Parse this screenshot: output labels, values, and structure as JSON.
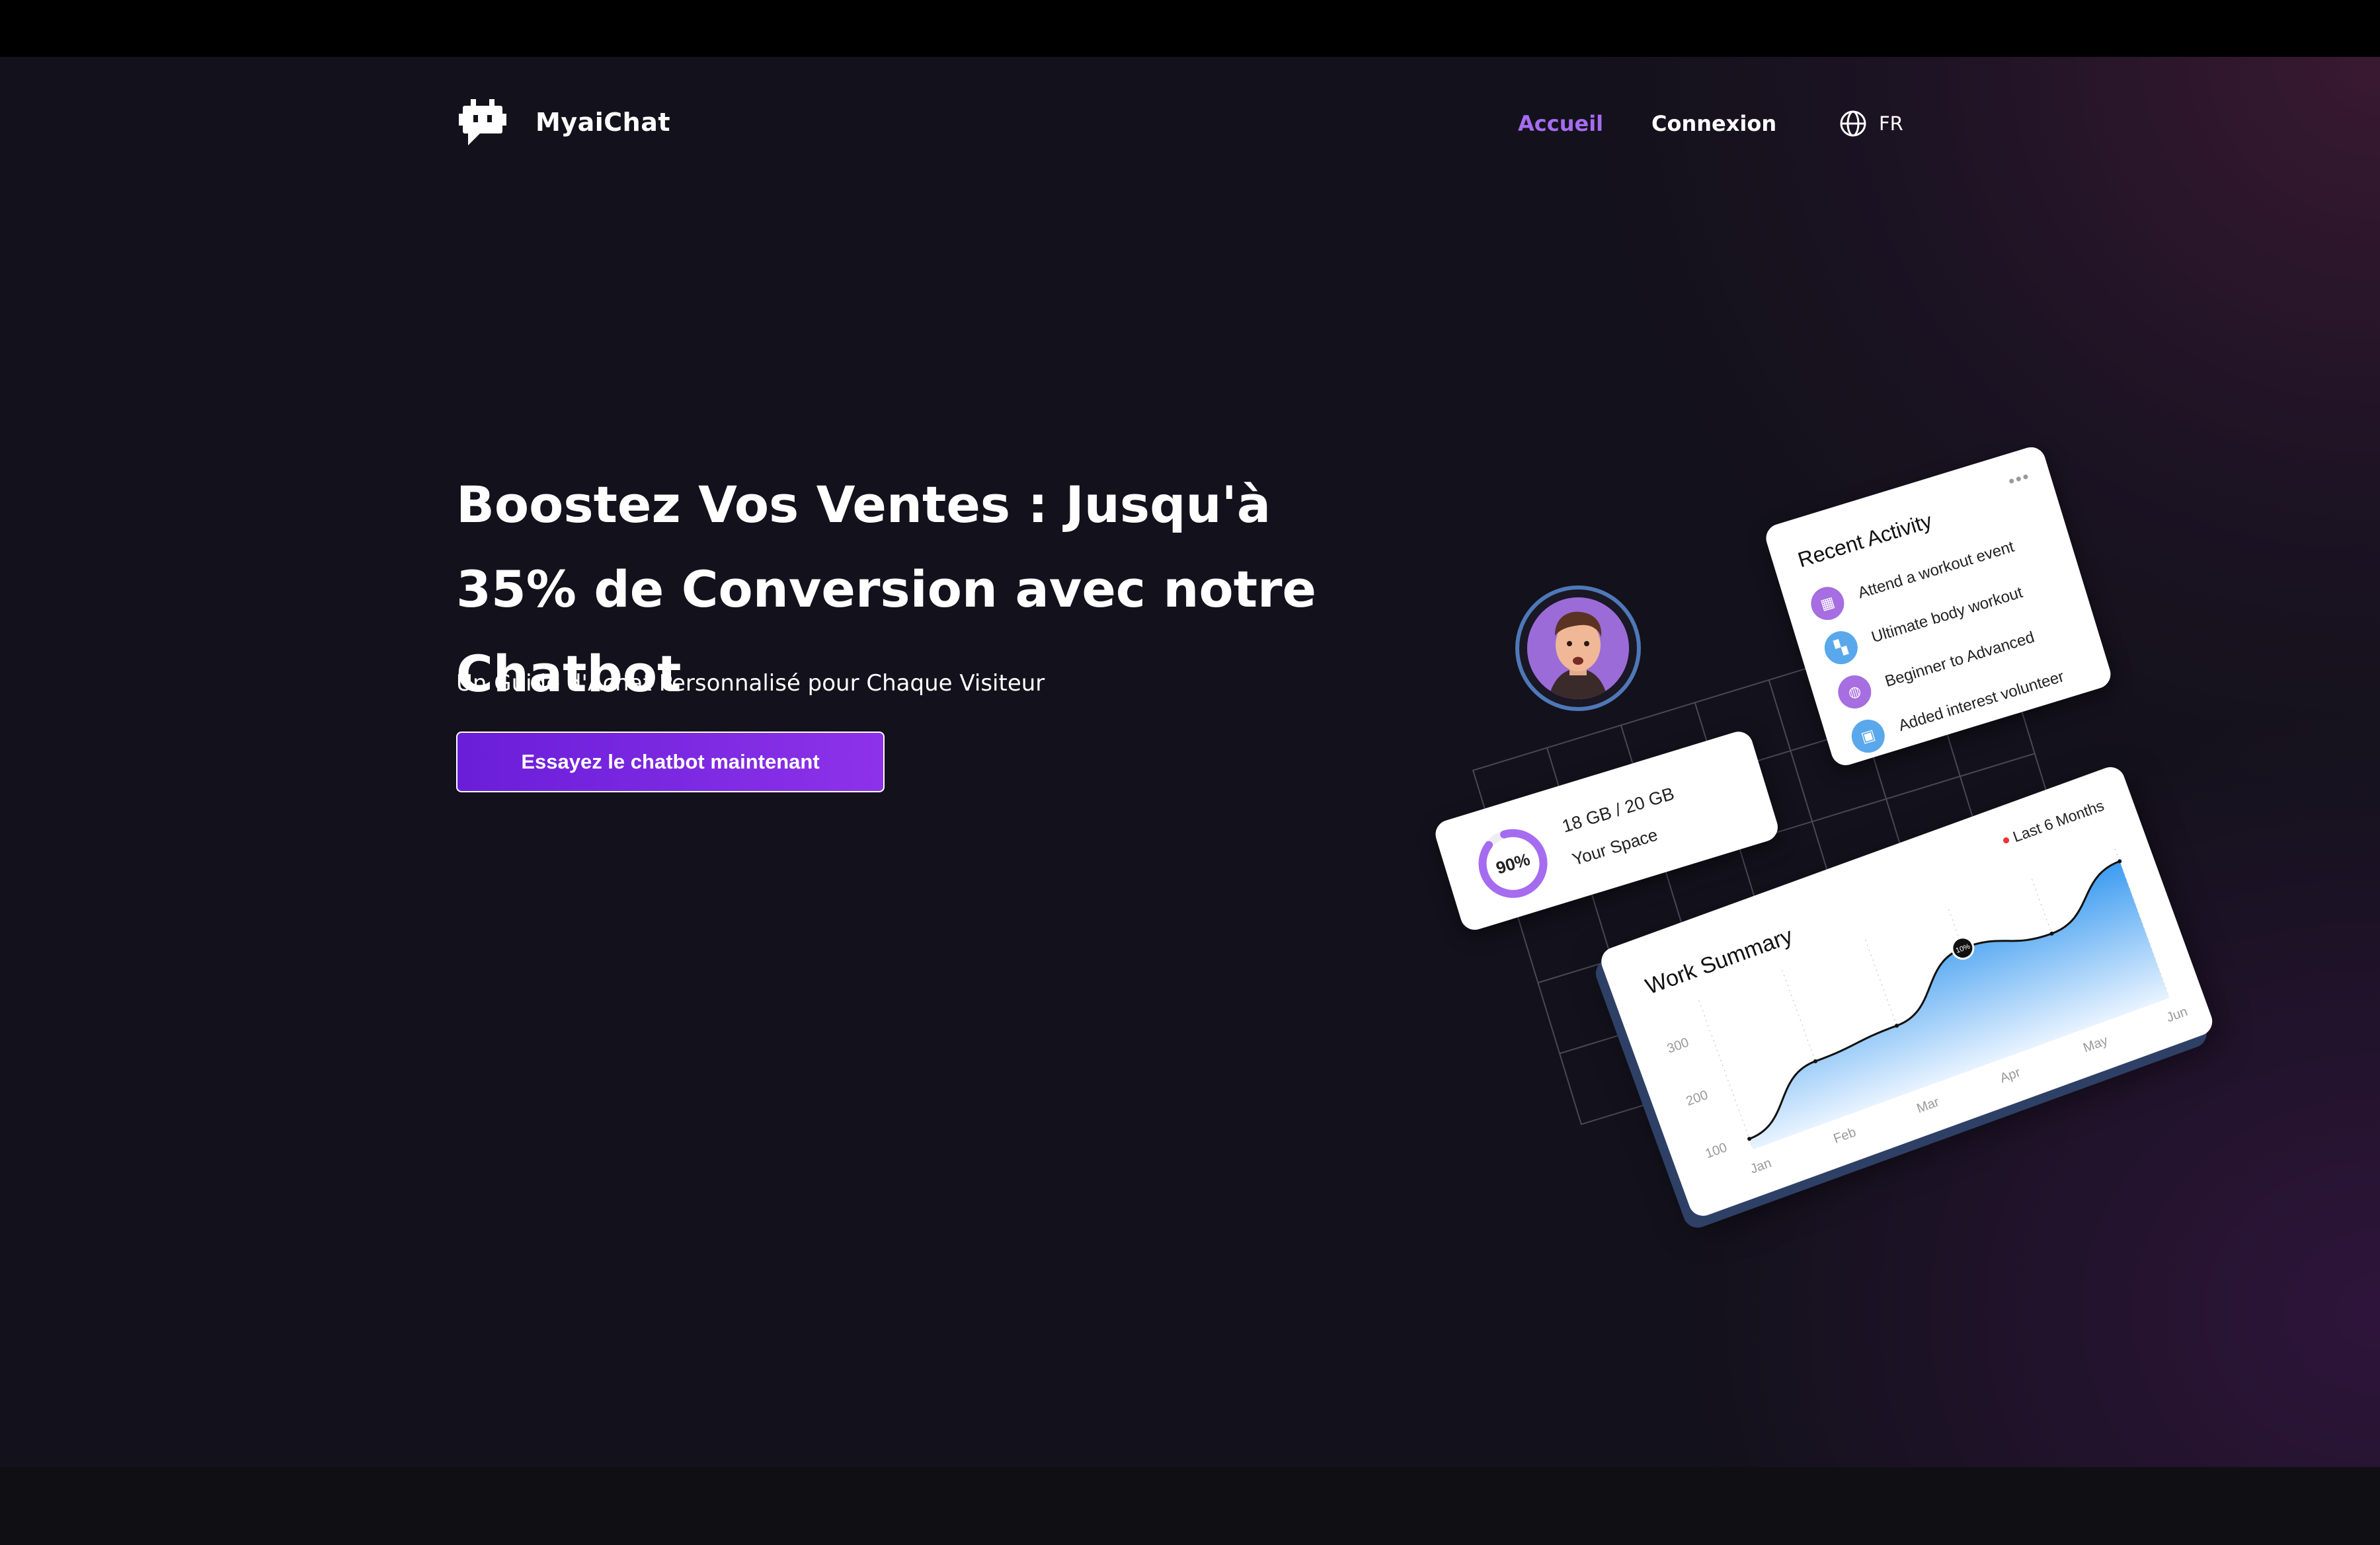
{
  "brand": {
    "name": "MyaiChat"
  },
  "nav": {
    "home": "Accueil",
    "login": "Connexion",
    "language": "FR"
  },
  "hero": {
    "title": "Boostez Vos Ventes : Jusqu'à 35% de Conversion avec notre Chatbot",
    "subtitle": "Un Guide d'Achat Personnalisé pour Chaque Visiteur",
    "cta": "Essayez le chatbot maintenant"
  },
  "activity": {
    "title": "Recent Activity",
    "more": "•••",
    "items": [
      {
        "label": "Attend a workout event",
        "icon": "calendar-icon",
        "color": "#a66ee0"
      },
      {
        "label": "Ultimate body workout",
        "icon": "grid-icon",
        "color": "#5aa8ec"
      },
      {
        "label": "Beginner to Advanced",
        "icon": "level-icon",
        "color": "#a66ee0"
      },
      {
        "label": "Added interest volunteer",
        "icon": "note-icon",
        "color": "#5aa8ec"
      }
    ]
  },
  "storage": {
    "percent_label": "90%",
    "percent": 0.9,
    "size": "18 GB / 20 GB",
    "label": "Your Space"
  },
  "summary": {
    "title": "Work Summary",
    "legend": "Last 6 Months",
    "marker_label": "10%"
  },
  "chart_data": {
    "type": "area",
    "title": "Work Summary",
    "categories": [
      "Jan",
      "Feb",
      "Mar",
      "Apr",
      "May",
      "Jun"
    ],
    "yticks": [
      "300",
      "200",
      "100"
    ],
    "values": [
      100,
      190,
      200,
      290,
      260,
      340
    ],
    "ylim": [
      80,
      340
    ],
    "legend": "Last 6 Months",
    "colors": {
      "fill_top": "#3d9cf0",
      "fill_bottom": "#e8f3ff",
      "line": "#111111"
    }
  },
  "colors": {
    "accent": "#a56cf0",
    "cta": "#7b26e0",
    "background": "#13111b"
  }
}
